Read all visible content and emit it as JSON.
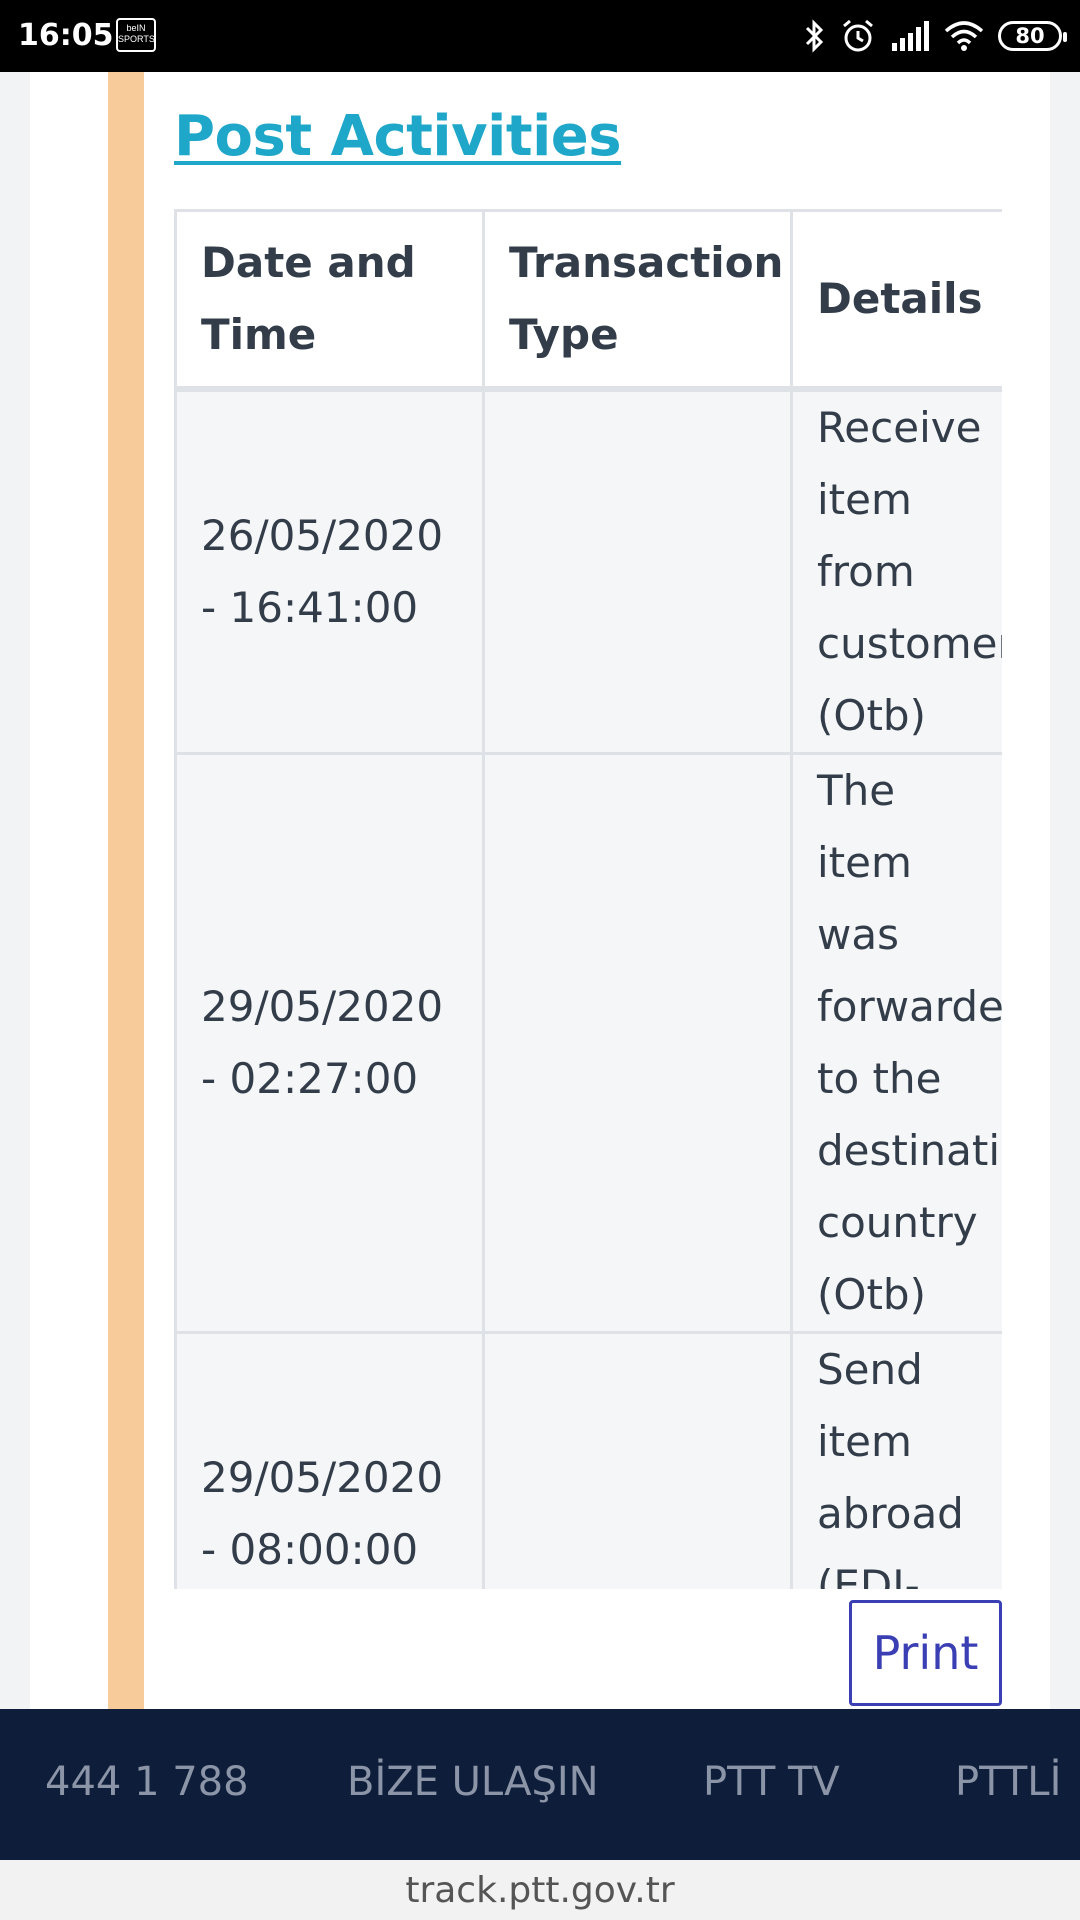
{
  "status_bar": {
    "time": "16:05",
    "app_badge": "beIN SPORTS",
    "battery": "80",
    "icons": [
      "bluetooth-icon",
      "alarm-icon",
      "signal-icon",
      "wifi-icon",
      "battery-icon"
    ]
  },
  "section": {
    "title": "Post Activities"
  },
  "table": {
    "headers": [
      "Date and Time",
      "Transaction Type",
      "Details"
    ],
    "rows": [
      {
        "date": "26/05/2020 - 16:41:00",
        "type": "",
        "details": "Receive item from customer (Otb)"
      },
      {
        "date": "29/05/2020 - 02:27:00",
        "type": "",
        "details": "The item was forwarded to the destination country (Otb)"
      },
      {
        "date": "29/05/2020 - 08:00:00",
        "type": "",
        "details": "Send item abroad (EDI-received)"
      }
    ]
  },
  "actions": {
    "print_label": "Print"
  },
  "footer": {
    "links": [
      "444 1 788",
      "BİZE ULAŞIN",
      "PTT TV",
      "PTTLİ"
    ]
  },
  "browser": {
    "url": "track.ptt.gov.tr"
  },
  "colors": {
    "accent_bar": "#f7cb9a",
    "title_link": "#1fa7c9",
    "footer_bg": "#0e1d3a",
    "print_button": "#3b3fb4"
  }
}
